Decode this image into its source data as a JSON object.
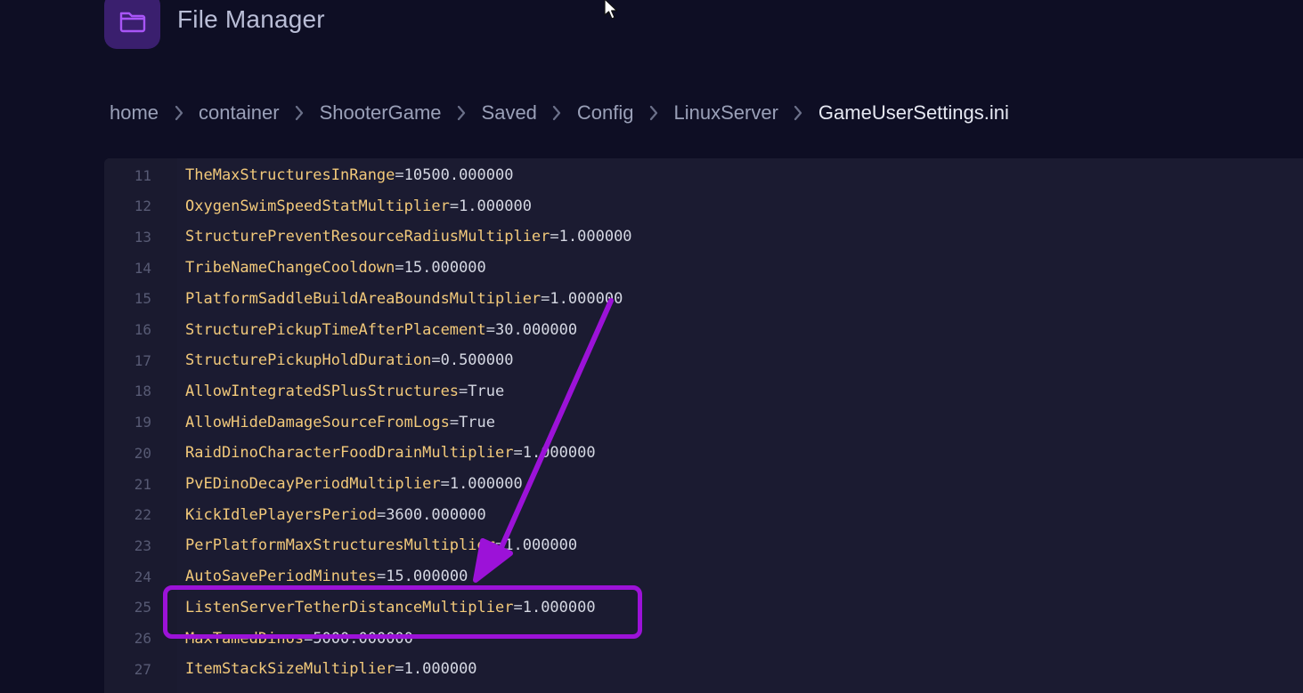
{
  "app": {
    "title": "File Manager",
    "icon": "folder-icon",
    "accent_color": "#9c12d8"
  },
  "breadcrumb": [
    {
      "label": "home"
    },
    {
      "label": "container"
    },
    {
      "label": "ShooterGame"
    },
    {
      "label": "Saved"
    },
    {
      "label": "Config"
    },
    {
      "label": "LinuxServer"
    },
    {
      "label": "GameUserSettings.ini"
    }
  ],
  "editor": {
    "lines": [
      {
        "num": "11",
        "key": "TheMaxStructuresInRange",
        "value": "10500.000000"
      },
      {
        "num": "12",
        "key": "OxygenSwimSpeedStatMultiplier",
        "value": "1.000000"
      },
      {
        "num": "13",
        "key": "StructurePreventResourceRadiusMultiplier",
        "value": "1.000000"
      },
      {
        "num": "14",
        "key": "TribeNameChangeCooldown",
        "value": "15.000000"
      },
      {
        "num": "15",
        "key": "PlatformSaddleBuildAreaBoundsMultiplier",
        "value": "1.000000"
      },
      {
        "num": "16",
        "key": "StructurePickupTimeAfterPlacement",
        "value": "30.000000"
      },
      {
        "num": "17",
        "key": "StructurePickupHoldDuration",
        "value": "0.500000"
      },
      {
        "num": "18",
        "key": "AllowIntegratedSPlusStructures",
        "value": "True"
      },
      {
        "num": "19",
        "key": "AllowHideDamageSourceFromLogs",
        "value": "True"
      },
      {
        "num": "20",
        "key": "RaidDinoCharacterFoodDrainMultiplier",
        "value": "1.000000"
      },
      {
        "num": "21",
        "key": "PvEDinoDecayPeriodMultiplier",
        "value": "1.000000"
      },
      {
        "num": "22",
        "key": "KickIdlePlayersPeriod",
        "value": "3600.000000"
      },
      {
        "num": "23",
        "key": "PerPlatformMaxStructuresMultiplier",
        "value": "1.000000"
      },
      {
        "num": "24",
        "key": "AutoSavePeriodMinutes",
        "value": "15.000000"
      },
      {
        "num": "25",
        "key": "ListenServerTetherDistanceMultiplier",
        "value": "1.000000"
      },
      {
        "num": "26",
        "key": "MaxTamedDinos",
        "value": "5000.000000"
      },
      {
        "num": "27",
        "key": "ItemStackSizeMultiplier",
        "value": "1.000000"
      }
    ]
  },
  "annotation": {
    "highlighted_line": "25",
    "color": "#9c12d8"
  }
}
